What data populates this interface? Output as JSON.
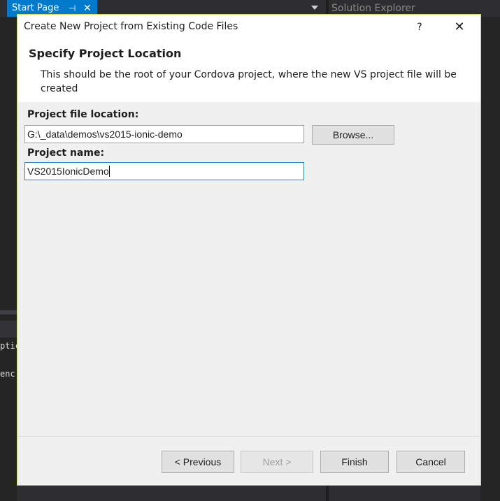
{
  "vs": {
    "tab_label": "Start Page",
    "tab_pin_icon": "pin-icon",
    "tab_close_icon": "close-icon",
    "side_panel_title": "Solution Explorer",
    "code_fragment_1": "ptic",
    "code_fragment_2": "enc"
  },
  "dialog": {
    "title": "Create New Project from Existing Code Files",
    "help_label": "?",
    "close_label": "✕",
    "header": {
      "title": "Specify Project Location",
      "description": "This should be the root of your Cordova project, where the new VS project file will be created"
    },
    "fields": {
      "location_label": "Project file location:",
      "location_value": "G:\\_data\\demos\\vs2015-ionic-demo",
      "browse_label": "Browse...",
      "name_label": "Project name:",
      "name_value": "VS2015IonicDemo"
    },
    "buttons": {
      "previous": "< Previous",
      "next": "Next >",
      "finish": "Finish",
      "cancel": "Cancel"
    }
  },
  "colors": {
    "accent": "#007acc",
    "dialog_border": "#c8d45a",
    "focus_border": "#2f7fb6"
  }
}
